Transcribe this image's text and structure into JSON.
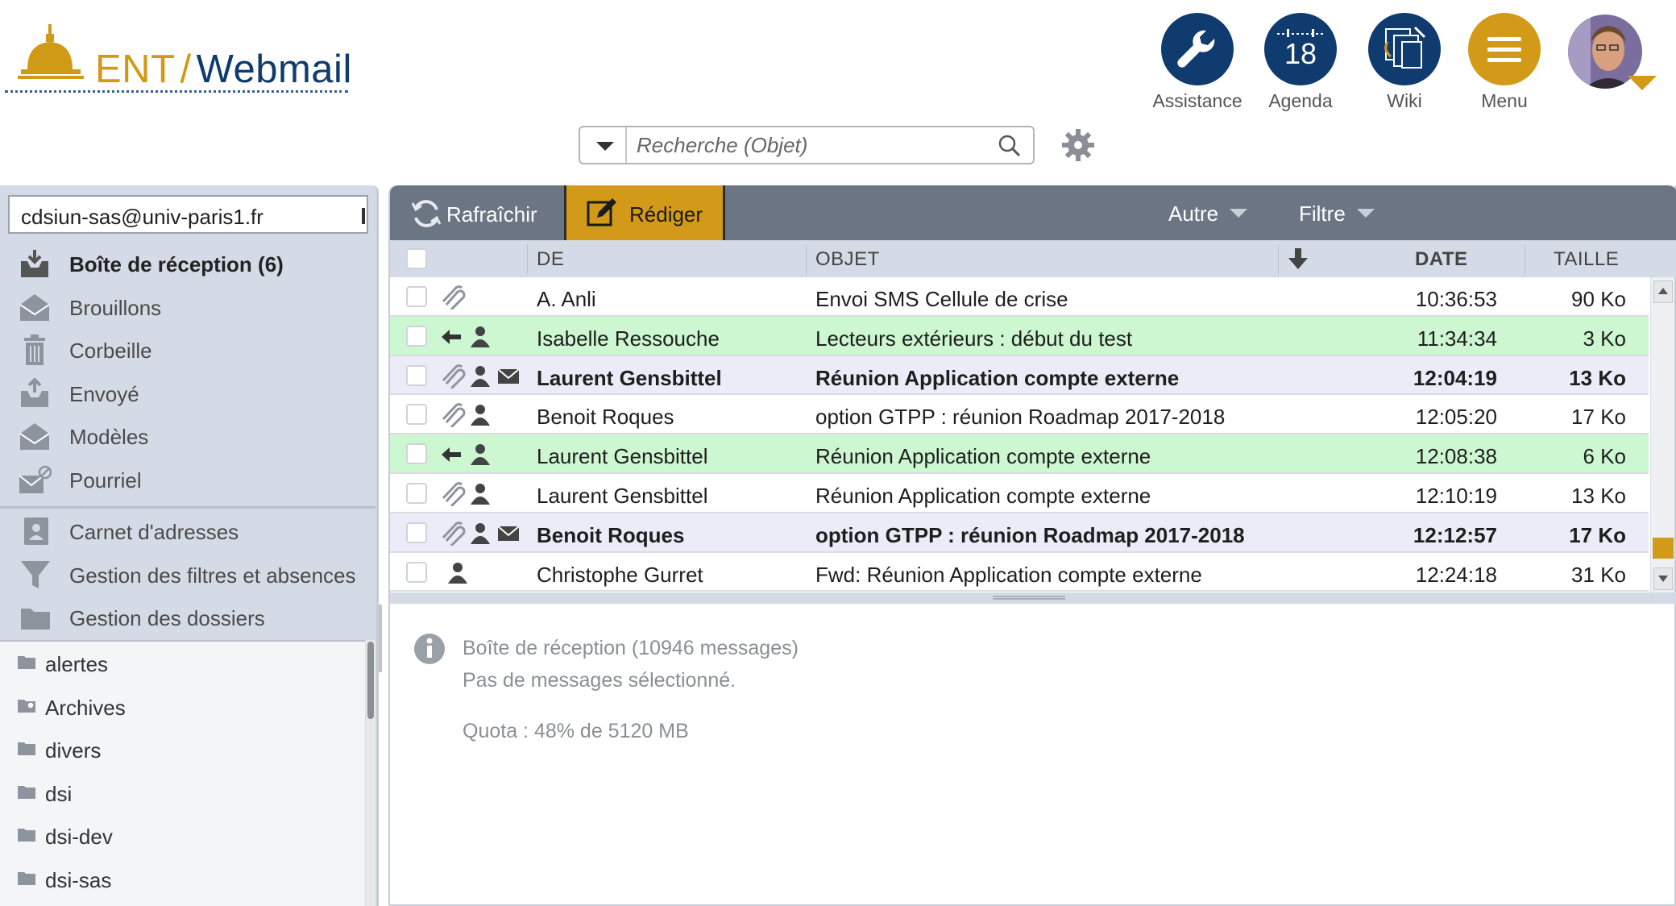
{
  "header": {
    "logo": {
      "part1": "ENT",
      "sep": "/",
      "part2": "Webmail"
    },
    "buttons": [
      {
        "label": "Assistance",
        "icon": "wrench-icon",
        "color": "#0f3b6e"
      },
      {
        "label": "Agenda",
        "icon": "calendar-icon",
        "day": "18",
        "color": "#0f3b6e"
      },
      {
        "label": "Wiki",
        "icon": "wiki-icon",
        "color": "#0f3b6e"
      },
      {
        "label": "Menu",
        "icon": "hamburger-icon",
        "color": "#d29a18"
      }
    ]
  },
  "search": {
    "placeholder": "Recherche (Objet)"
  },
  "sidebar": {
    "account": "cdsiun-sas@univ-paris1.fr",
    "system_folders": [
      {
        "label": "Boîte de réception (6)",
        "icon": "inbox-icon"
      },
      {
        "label": "Brouillons",
        "icon": "drafts-icon"
      },
      {
        "label": "Corbeille",
        "icon": "trash-icon"
      },
      {
        "label": "Envoyé",
        "icon": "sent-icon"
      },
      {
        "label": "Modèles",
        "icon": "templates-icon"
      },
      {
        "label": "Pourriel",
        "icon": "spam-icon"
      }
    ],
    "tools": [
      {
        "label": "Carnet d'adresses",
        "icon": "addressbook-icon"
      },
      {
        "label": "Gestion des filtres et absences",
        "icon": "filter-icon"
      },
      {
        "label": "Gestion des dossiers",
        "icon": "folder-icon"
      }
    ],
    "user_folders": [
      "alertes",
      "Archives",
      "divers",
      "dsi",
      "dsi-dev",
      "dsi-sas"
    ]
  },
  "toolbar": {
    "refresh": "Rafraîchir",
    "compose": "Rédiger",
    "other": "Autre",
    "filter": "Filtre"
  },
  "columns": {
    "from": "DE",
    "subject": "OBJET",
    "date": "DATE",
    "size": "TAILLE"
  },
  "messages": [
    {
      "from": "A. Anli",
      "subject": "Envoi SMS Cellule de crise",
      "date": "10:36:53",
      "size": "90 Ko",
      "state": "read",
      "icons": [
        "attachment"
      ]
    },
    {
      "from": "Isabelle Ressouche",
      "subject": "Lecteurs extérieurs : début du test",
      "date": "11:34:34",
      "size": "3 Ko",
      "state": "replied",
      "icons": [
        "reply",
        "person"
      ]
    },
    {
      "from": "Laurent Gensbittel",
      "subject": "Réunion Application compte externe",
      "date": "12:04:19",
      "size": "13 Ko",
      "state": "unread",
      "icons": [
        "attachment",
        "person",
        "envelope"
      ]
    },
    {
      "from": "Benoit Roques",
      "subject": "option GTPP : réunion Roadmap 2017-2018",
      "date": "12:05:20",
      "size": "17 Ko",
      "state": "read",
      "icons": [
        "attachment",
        "person"
      ]
    },
    {
      "from": "Laurent Gensbittel",
      "subject": "Réunion Application compte externe",
      "date": "12:08:38",
      "size": "6 Ko",
      "state": "replied",
      "icons": [
        "reply",
        "person"
      ]
    },
    {
      "from": "Laurent Gensbittel",
      "subject": "Réunion Application compte externe",
      "date": "12:10:19",
      "size": "13 Ko",
      "state": "read",
      "icons": [
        "attachment",
        "person"
      ]
    },
    {
      "from": "Benoit Roques",
      "subject": "option GTPP : réunion Roadmap 2017-2018",
      "date": "12:12:57",
      "size": "17 Ko",
      "state": "unread",
      "icons": [
        "attachment",
        "person",
        "envelope"
      ]
    },
    {
      "from": "Christophe Gurret",
      "subject": "Fwd: Réunion Application compte externe",
      "date": "12:24:18",
      "size": "31 Ko",
      "state": "read",
      "icons": [
        "person"
      ]
    }
  ],
  "preview": {
    "folder_info": "Boîte de réception (10946 messages)",
    "no_selection": "Pas de messages sélectionné.",
    "quota": "Quota : 48% de 5120 MB"
  },
  "colors": {
    "gold": "#d29a18",
    "navy": "#0f3b6e",
    "replied_row": "#ccf7d0",
    "unread_row": "#ececf8"
  }
}
